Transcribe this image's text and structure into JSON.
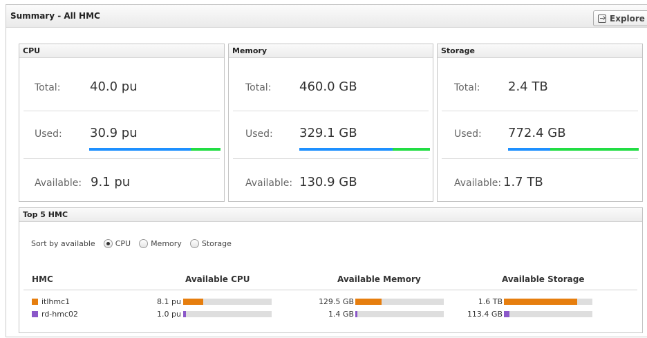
{
  "summary": {
    "title": "Summary - All HMC",
    "explore_label": "Explore"
  },
  "panels": {
    "cpu": {
      "title": "CPU",
      "total_label": "Total:",
      "total_value": "40.0 pu",
      "used_label": "Used:",
      "used_value": "30.9 pu",
      "available_label": "Available:",
      "available_value": "9.1 pu",
      "used_fraction": 0.772
    },
    "memory": {
      "title": "Memory",
      "total_label": "Total:",
      "total_value": "460.0 GB",
      "used_label": "Used:",
      "used_value": "329.1 GB",
      "available_label": "Available:",
      "available_value": "130.9 GB",
      "used_fraction": 0.715
    },
    "storage": {
      "title": "Storage",
      "total_label": "Total:",
      "total_value": "2.4 TB",
      "used_label": "Used:",
      "used_value": "772.4 GB",
      "available_label": "Available:",
      "available_value": "1.7 TB",
      "used_fraction": 0.322
    }
  },
  "top5": {
    "title": "Top 5 HMC",
    "sort_label": "Sort by available",
    "sort_options": [
      "CPU",
      "Memory",
      "Storage"
    ],
    "sort_selected": "CPU",
    "columns": {
      "hmc": "HMC",
      "cpu": "Available CPU",
      "memory": "Available Memory",
      "storage": "Available Storage"
    },
    "rows": [
      {
        "name": "itlhmc1",
        "color": "#e67e0e",
        "cpu": "8.1 pu",
        "cpu_fraction": 0.23,
        "memory": "129.5 GB",
        "memory_fraction": 0.3,
        "storage": "1.6 TB",
        "storage_fraction": 0.83
      },
      {
        "name": "rd-hmc02",
        "color": "#8b58c9",
        "cpu": "1.0 pu",
        "cpu_fraction": 0.03,
        "memory": "1.4 GB",
        "memory_fraction": 0.01,
        "storage": "113.4 GB",
        "storage_fraction": 0.06
      }
    ]
  },
  "colors": {
    "used_bar": "#1e90ff",
    "free_bar": "#22dd44",
    "bar_track": "#dedede"
  }
}
